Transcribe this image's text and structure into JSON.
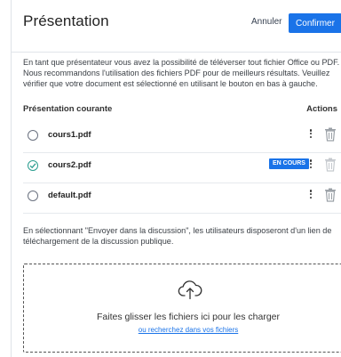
{
  "header": {
    "title": "Présentation",
    "cancel_label": "Annuler",
    "confirm_label": "Confirmer"
  },
  "intro_text": "En tant que présentateur vous avez la possibilité de téléverser tout fichier Office ou PDF. Nous recommandons l'utilisation des fichiers PDF pour de meilleurs résultats. Veuillez vérifier que votre document est sélectionné en utilisant le bouton en bas à gauche.",
  "table": {
    "col_current": "Présentation courante",
    "col_actions": "Actions",
    "rows": [
      {
        "filename": "cours1.pdf",
        "selected": false,
        "badge": ""
      },
      {
        "filename": "cours2.pdf",
        "selected": true,
        "badge": "EN COURS"
      },
      {
        "filename": "default.pdf",
        "selected": false,
        "badge": ""
      }
    ]
  },
  "note_text": "En sélectionnant \"Envoyer dans la discussion\", les utilisateurs disposeront d'un lien de téléchargement de la discussion publique.",
  "dropzone": {
    "text": "Faites glisser les fichiers ici pour les charger",
    "link": "ou recherchez dans vos fichiers"
  },
  "colors": {
    "accent": "#1a73e8",
    "selected_check": "#2a9d8f"
  },
  "icons": [
    "radio-icon",
    "check-icon",
    "kebab-menu-icon",
    "trash-icon",
    "cloud-upload-icon"
  ]
}
